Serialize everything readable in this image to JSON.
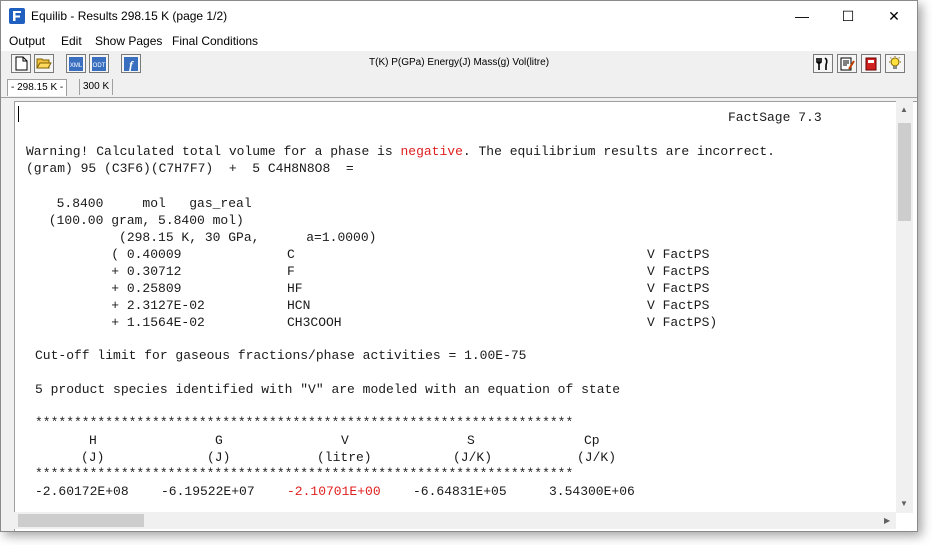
{
  "window": {
    "title": "Equilib - Results  298.15 K  (page 1/2)",
    "controls": {
      "minimize": "—",
      "maximize": "☐",
      "close": "✕"
    }
  },
  "menu": [
    "Output",
    "Edit",
    "Show Pages",
    "Final Conditions"
  ],
  "toolbar": {
    "units": "T(K)  P(GPa)  Energy(J)  Mass(g)  Vol(litre)",
    "left_buttons": [
      "new-file-icon",
      "open-folder-icon",
      "xml-icon",
      "odt-icon",
      "f-function-icon"
    ],
    "right_buttons": [
      "fork-knife-icon",
      "edit-doc-icon",
      "book-icon",
      "lightbulb-icon"
    ],
    "xml_label": "XML",
    "odt_label": "ODT",
    "f_label": "f"
  },
  "tabs": [
    "- 298.15 K -",
    "300 K"
  ],
  "output": {
    "header": "FactSage 7.3",
    "warning_before": "Warning! Calculated total volume for a phase is ",
    "warning_highlight": "negative",
    "warning_after": ". The equilibrium results are incorrect.",
    "reactants": "(gram) 95 (C3F6)(C7H7F7)  +  5 C4H8N8O8  =",
    "phase_line1": "  5.8400     mol   gas_real",
    "phase_line2": " (100.00 gram, 5.8400 mol)",
    "phase_line3": "          (298.15 K, 30 GPa,      a=1.0000)",
    "species": [
      {
        "prefix": "         ( ",
        "amount": "0.40009",
        "name": "C",
        "tag": "V FactPS"
      },
      {
        "prefix": "         + ",
        "amount": "0.30712",
        "name": "F",
        "tag": "V FactPS"
      },
      {
        "prefix": "         + ",
        "amount": "0.25809",
        "name": "HF",
        "tag": "V FactPS"
      },
      {
        "prefix": "         + ",
        "amount": "2.3127E-02",
        "name": "HCN",
        "tag": "V FactPS"
      },
      {
        "prefix": "         + ",
        "amount": "1.1564E-02",
        "name": "CH3COOH",
        "tag": "V FactPS)"
      }
    ],
    "cutoff": "Cut-off limit for gaseous fractions/phase activities = 1.00E-75",
    "eos_note": "5 product species identified with \"V\" are modeled with an equation of state",
    "stars": "*********************************************************************",
    "thermo_headers": [
      "H",
      "G",
      "V",
      "S",
      "Cp"
    ],
    "thermo_units": [
      "(J)",
      "(J)",
      "(litre)",
      "(J/K)",
      "(J/K)"
    ],
    "thermo_values": [
      "-2.60172E+08",
      "-6.19522E+07",
      "-2.10701E+00",
      "-6.64831E+05",
      "3.54300E+06"
    ]
  },
  "colors": {
    "negative": "#e02020",
    "text": "#1a1a1a"
  }
}
